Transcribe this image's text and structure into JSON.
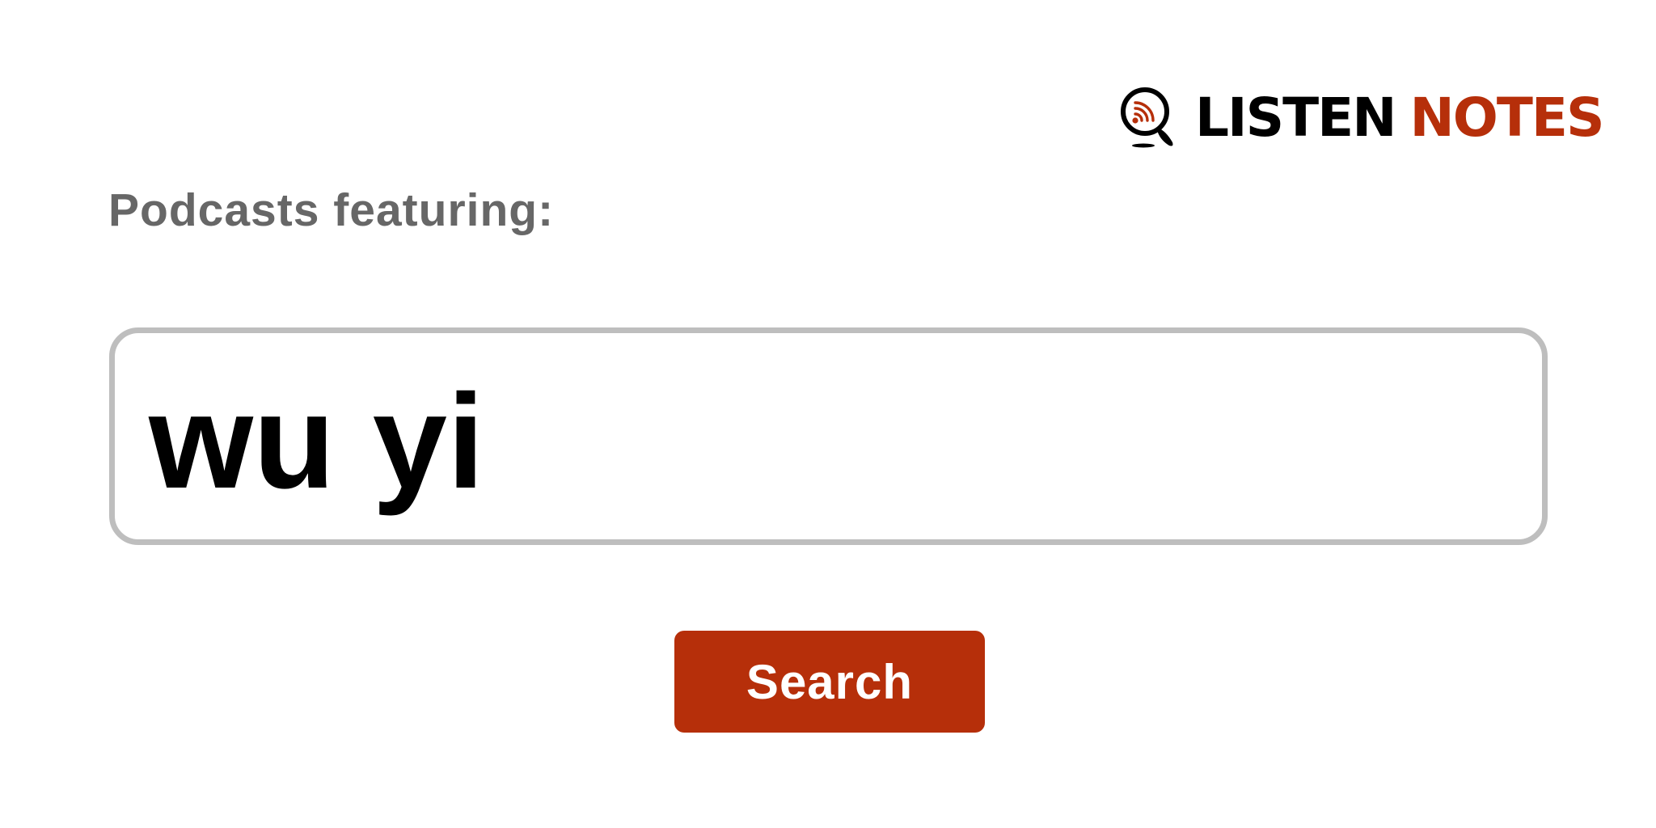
{
  "brand": {
    "logo_word_1": "LISTEN",
    "logo_word_2": "NOTES",
    "logo_icon": "magnifier-podcast-icon",
    "colors": {
      "accent": "#b62f0a",
      "dark": "#000000",
      "heading": "#676767",
      "border": "#bebebe"
    }
  },
  "heading": "Podcasts featuring:",
  "search": {
    "value": "wu yi"
  },
  "search_button": {
    "label": "Search"
  }
}
